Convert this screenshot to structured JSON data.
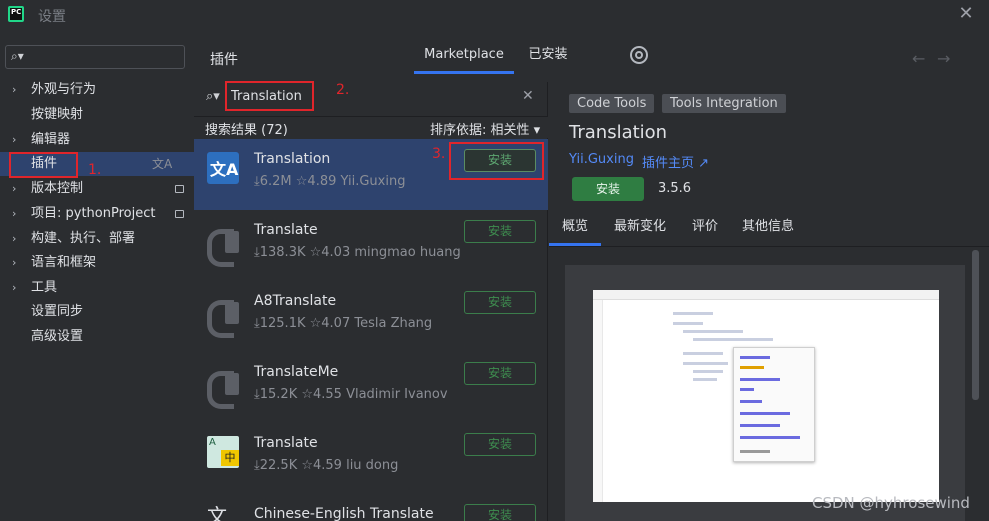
{
  "window": {
    "title": "设置",
    "close": "✕"
  },
  "sidebar": {
    "search_placeholder": "",
    "items": [
      {
        "label": "外观与行为",
        "chevron": "›"
      },
      {
        "label": "按键映射",
        "chevron": ""
      },
      {
        "label": "编辑器",
        "chevron": "›"
      },
      {
        "label": "插件",
        "chevron": "",
        "translate_icon": "文A"
      },
      {
        "label": "版本控制",
        "chevron": "›"
      },
      {
        "label": "项目: pythonProject",
        "chevron": "›"
      },
      {
        "label": "构建、执行、部署",
        "chevron": "›"
      },
      {
        "label": "语言和框架",
        "chevron": "›"
      },
      {
        "label": "工具",
        "chevron": "›"
      },
      {
        "label": "设置同步",
        "chevron": ""
      },
      {
        "label": "高级设置",
        "chevron": ""
      }
    ]
  },
  "plugins": {
    "title": "插件",
    "tabs": {
      "marketplace": "Marketplace",
      "installed": "已安装"
    },
    "nav": {
      "back": "←",
      "forward": "→"
    },
    "search_value": "Translation",
    "clear": "✕",
    "results_label": "搜索结果 (72)",
    "sort_label": "排序依据: 相关性 ▾",
    "list": [
      {
        "name": "Translation",
        "meta": "⤓6.2M  ☆4.89  Yii.Guxing",
        "install": "安装",
        "icon": "translate-blue"
      },
      {
        "name": "Translate",
        "meta": "⤓138.3K  ☆4.03  mingmao huang",
        "install": "安装",
        "icon": "plug-gray"
      },
      {
        "name": "A8Translate",
        "meta": "⤓125.1K  ☆4.07  Tesla Zhang",
        "install": "安装",
        "icon": "plug-gray"
      },
      {
        "name": "TranslateMe",
        "meta": "⤓15.2K  ☆4.55  Vladimir Ivanov",
        "install": "安装",
        "icon": "plug-gray"
      },
      {
        "name": "Translate",
        "meta": "⤓22.5K  ☆4.59  liu dong",
        "install": "安装",
        "icon": "translate-green"
      },
      {
        "name": "Chinese-English Translate",
        "meta": "",
        "install": "安装",
        "icon": "wen"
      }
    ]
  },
  "detail": {
    "tags": [
      "Code Tools",
      "Tools Integration"
    ],
    "title": "Translation",
    "author": "Yii.Guxing",
    "homepage": "插件主页 ↗",
    "install": "安装",
    "version": "3.5.6",
    "tabs": [
      "概览",
      "最新变化",
      "评价",
      "其他信息"
    ]
  },
  "annotations": {
    "a1": "1.",
    "a2": "2.",
    "a3": "3."
  },
  "watermark": "CSDN @hyhrosewind"
}
